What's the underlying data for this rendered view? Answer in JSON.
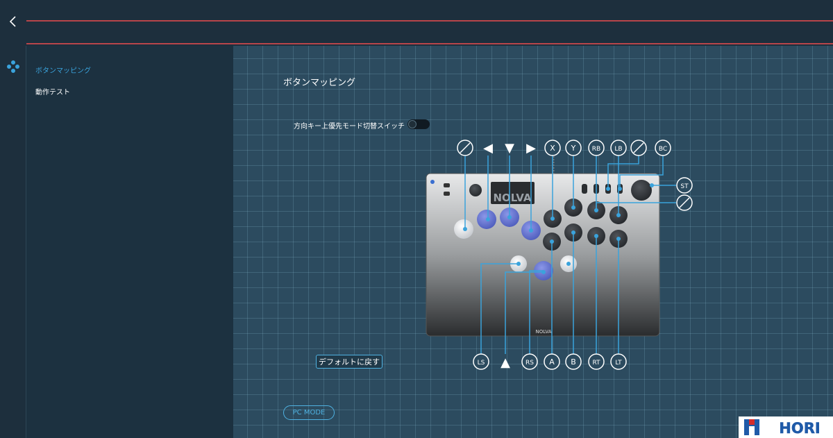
{
  "header": {
    "back_icon": "chevron-left-icon"
  },
  "sidebar": {
    "icon": "gamepad-buttons-icon",
    "items": [
      {
        "label": "ボタンマッピング",
        "active": true
      },
      {
        "label": "動作テスト",
        "active": false
      }
    ]
  },
  "main": {
    "title": "ボタンマッピング",
    "toggle": {
      "label": "方向キー上優先モード切替スイッチ",
      "on": false
    },
    "default_button": "デフォルトに戻す",
    "pc_mode_button": "PC MODE"
  },
  "controller": {
    "brand": "NOLVA",
    "bottom_brand": "NOLVA"
  },
  "labels": {
    "top": [
      "⊘",
      "◀",
      "▼",
      "▶",
      "X",
      "Y",
      "RB",
      "LB",
      "⊘",
      "BC"
    ],
    "right": [
      "ST",
      "⊘"
    ],
    "bottom": [
      "LS",
      "▲",
      "RS",
      "A",
      "B",
      "RT",
      "LT"
    ]
  },
  "logo": {
    "text": "HORI"
  },
  "colors": {
    "accent": "#4fb2e2",
    "accent_line": "#3aa3dc",
    "header_red": "#b8454a",
    "button_blue": "#5d6fd0",
    "button_white": "#dfe2e6",
    "button_dark": "#3a3e44"
  }
}
